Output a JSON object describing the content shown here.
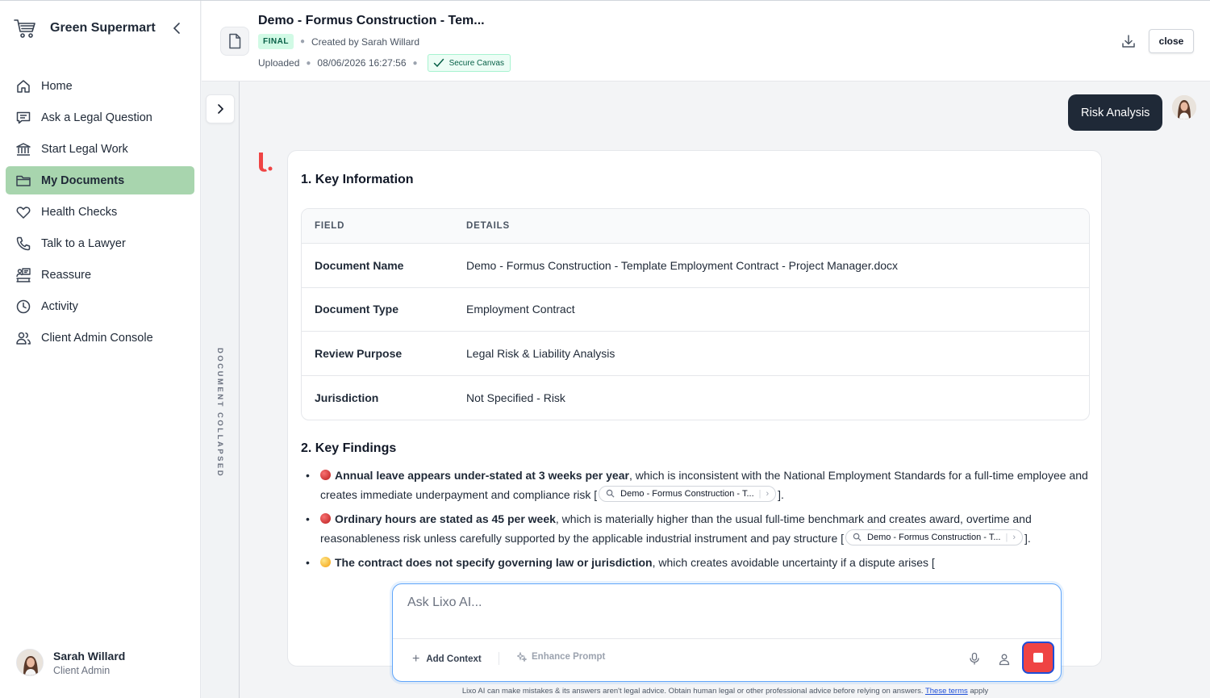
{
  "sidebar": {
    "brand": "Green Supermart",
    "items": [
      {
        "label": "Home",
        "icon": "home-icon",
        "active": false
      },
      {
        "label": "Ask a Legal Question",
        "icon": "chat-icon",
        "active": false
      },
      {
        "label": "Start Legal Work",
        "icon": "bank-icon",
        "active": false
      },
      {
        "label": "My Documents",
        "icon": "folder-icon",
        "active": true
      },
      {
        "label": "Health Checks",
        "icon": "heart-icon",
        "active": false
      },
      {
        "label": "Talk to a Lawyer",
        "icon": "phone-icon",
        "active": false
      },
      {
        "label": "Reassure",
        "icon": "reassure-icon",
        "active": false
      },
      {
        "label": "Activity",
        "icon": "clock-icon",
        "active": false
      },
      {
        "label": "Client Admin Console",
        "icon": "users-icon",
        "active": false
      }
    ],
    "user": {
      "name": "Sarah Willard",
      "role": "Client Admin"
    }
  },
  "header": {
    "title": "Demo - Formus Construction - Tem...",
    "status_badge": "FINAL",
    "created_by": "Created by Sarah Willard",
    "uploaded_label": "Uploaded",
    "uploaded_at": "08/06/2026 16:27:56",
    "secure_label": "Secure Canvas",
    "close_label": "close"
  },
  "strip": {
    "label": "DOCUMENT COLLAPSED"
  },
  "chat": {
    "user_message": "Risk Analysis",
    "section1_title": "1. Key Information",
    "table": {
      "headers": [
        "FIELD",
        "DETAILS"
      ],
      "rows": [
        {
          "field": "Document Name",
          "details": "Demo - Formus Construction - Template Employment Contract - Project Manager.docx"
        },
        {
          "field": "Document Type",
          "details": "Employment Contract"
        },
        {
          "field": "Review Purpose",
          "details": "Legal Risk & Liability Analysis"
        },
        {
          "field": "Jurisdiction",
          "details": "Not Specified - Risk"
        }
      ]
    },
    "section2_title": "2. Key Findings",
    "findings": [
      {
        "severity": "red",
        "bold": "Annual leave appears under-stated at 3 weeks per year",
        "text": ", which is inconsistent with the National Employment Standards for a full-time employee and creates immediate underpayment and compliance risk [",
        "chip": "Demo - Formus Construction - T...",
        "end": "]."
      },
      {
        "severity": "red",
        "bold": "Ordinary hours are stated as 45 per week",
        "text": ", which is materially higher than the usual full-time benchmark and creates award, overtime and reasonableness risk unless carefully supported by the applicable industrial instrument and pay structure [",
        "chip": "Demo - Formus Construction - T...",
        "end": "]."
      },
      {
        "severity": "yellow",
        "bold": "The contract does not specify governing law or jurisdiction",
        "text": ", which creates avoidable uncertainty if a dispute arises [",
        "chip": "",
        "end": ""
      }
    ]
  },
  "composer": {
    "placeholder": "Ask Lixo AI...",
    "add_context": "Add Context",
    "enhance_prompt": "Enhance Prompt"
  },
  "disclaimer": {
    "text": "Lixo AI can make mistakes & its answers aren't legal advice. Obtain human legal or other professional advice before relying on answers. ",
    "link": "These terms",
    "after": " apply"
  },
  "colors": {
    "active_nav": "#a8d5ae",
    "bubble": "#1f2937",
    "stop": "#ef4444",
    "focus": "#60a5fa"
  }
}
